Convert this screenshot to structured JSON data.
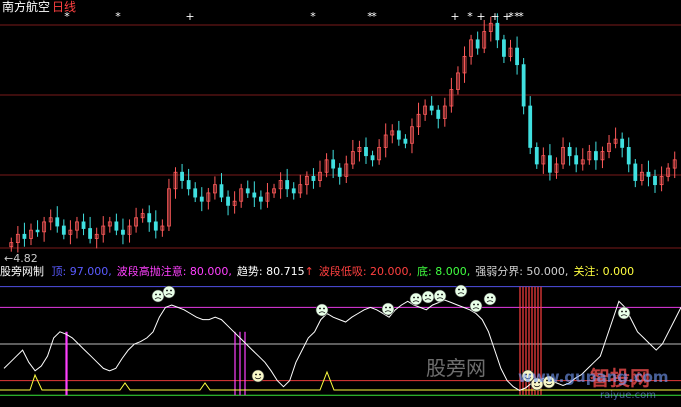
{
  "header": {
    "stock_name": "南方航空",
    "period": "日线",
    "price_marker": "4.82"
  },
  "indicator": {
    "name": "股旁网制",
    "items": [
      {
        "label": "顶:",
        "value": "97.000,",
        "color": "#5a5aff"
      },
      {
        "label": "波段高抛注意:",
        "value": "80.000,",
        "color": "#ff40ff"
      },
      {
        "label": "趋势:",
        "value": "80.715",
        "arrow": "↑",
        "color": "#ffffff"
      },
      {
        "label": "波段低吸:",
        "value": "20.000,",
        "color": "#ff4040"
      },
      {
        "label": "底:",
        "value": "8.000,",
        "color": "#40ff40"
      },
      {
        "label": "强弱分界:",
        "value": "50.000,",
        "color": "#d0d0d0"
      },
      {
        "label": "关注:",
        "value": "0.000",
        "color": "#ffff40"
      }
    ]
  },
  "watermarks": {
    "left": "股旁网",
    "right_cn": "智投网",
    "right_url": "www.gupang.com",
    "right_small": "raiyue.com"
  },
  "colors": {
    "up": "#ff5a5a",
    "down": "#40e0e0",
    "trend": "#ffffff",
    "top": "#5a5aff",
    "high_alert": "#ff40ff",
    "low_buy": "#ff4040",
    "bottom": "#40ff40",
    "midline": "#d0d0d0",
    "focus": "#ffff40",
    "face": "#e8ffe8"
  },
  "chart_data": [
    {
      "type": "candlestick",
      "title": "南方航空 日线",
      "min_price_label": "4.82",
      "note": "Daily close trend (approximate relative values)",
      "close": [
        4.95,
        5.05,
        5.0,
        5.1,
        5.08,
        5.2,
        5.25,
        5.15,
        5.05,
        5.1,
        5.2,
        5.12,
        5.0,
        5.05,
        5.15,
        5.2,
        5.1,
        5.05,
        5.15,
        5.25,
        5.3,
        5.2,
        5.1,
        5.15,
        5.6,
        5.8,
        5.7,
        5.6,
        5.5,
        5.45,
        5.55,
        5.65,
        5.5,
        5.4,
        5.45,
        5.6,
        5.55,
        5.5,
        5.45,
        5.55,
        5.6,
        5.7,
        5.6,
        5.55,
        5.65,
        5.75,
        5.7,
        5.8,
        5.95,
        5.85,
        5.75,
        5.9,
        6.05,
        6.1,
        6.0,
        5.95,
        6.1,
        6.25,
        6.3,
        6.2,
        6.15,
        6.35,
        6.5,
        6.6,
        6.55,
        6.45,
        6.6,
        6.8,
        7.0,
        7.2,
        7.4,
        7.3,
        7.5,
        7.6,
        7.4,
        7.2,
        7.3,
        7.1,
        6.6,
        6.1,
        5.9,
        6.0,
        5.8,
        5.9,
        6.1,
        6.0,
        5.9,
        5.95,
        6.05,
        5.95,
        6.05,
        6.15,
        6.2,
        6.1,
        5.9,
        5.7,
        5.8,
        5.75,
        5.65,
        5.75,
        5.85,
        5.95
      ],
      "event_markers": [
        "*",
        "*",
        "+",
        "*",
        "*",
        "*",
        "+",
        "*",
        "+",
        "+",
        "+",
        "*",
        "*",
        "*"
      ]
    },
    {
      "type": "line",
      "title": "股旁网制",
      "series": [
        {
          "name": "趋势",
          "color": "#ffffff",
          "values": [
            30,
            35,
            40,
            45,
            35,
            28,
            32,
            40,
            55,
            60,
            58,
            55,
            50,
            45,
            40,
            35,
            30,
            28,
            30,
            38,
            45,
            50,
            52,
            55,
            60,
            72,
            80,
            82,
            80,
            78,
            75,
            72,
            70,
            70,
            72,
            70,
            65,
            60,
            55,
            50,
            45,
            40,
            35,
            28,
            20,
            15,
            20,
            35,
            45,
            55,
            60,
            70,
            75,
            72,
            70,
            68,
            72,
            75,
            78,
            80,
            78,
            75,
            72,
            78,
            82,
            85,
            82,
            80,
            78,
            82,
            84,
            86,
            84,
            82,
            80,
            78,
            75,
            70,
            60,
            45,
            30,
            20,
            15,
            12,
            14,
            18,
            20,
            22,
            20,
            18,
            16,
            18,
            22,
            25,
            30,
            35,
            40,
            55,
            70,
            85,
            80,
            70,
            60,
            55,
            50,
            45,
            50,
            60,
            70,
            80
          ],
          "ylim": [
            0,
            100
          ]
        }
      ],
      "levels": {
        "顶": 97,
        "波段高抛注意": 80,
        "波段低吸": 20,
        "底": 8,
        "强弱分界": 50,
        "关注": 0
      }
    }
  ]
}
